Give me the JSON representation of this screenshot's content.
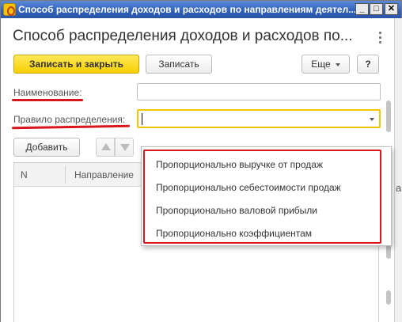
{
  "window": {
    "title": "Способ распределения доходов и расходов по направлениям деятел...",
    "min": "_",
    "max": "□",
    "close": "✕"
  },
  "form": {
    "title": "Способ распределения доходов и расходов по...",
    "more_icon": "vertical-dots-icon"
  },
  "toolbar": {
    "save_close_label": "Записать и закрыть",
    "save_label": "Записать",
    "more_label": "Еще",
    "help_label": "?"
  },
  "fields": {
    "name_label": "Наименование:",
    "name_value": "",
    "rule_label": "Правило распределения:",
    "rule_value": ""
  },
  "table_toolbar": {
    "add_label": "Добавить"
  },
  "table": {
    "columns": [
      "N",
      "Направление"
    ]
  },
  "dropdown": {
    "options": [
      "Пропорционально выручке от продаж",
      "Пропорционально себестоимости продаж",
      "Пропорционально валовой прибыли",
      "Пропорционально коэффициентам"
    ]
  },
  "background": {
    "text": "а"
  },
  "colors": {
    "accent": "#f7cf00",
    "highlight": "#e0141c",
    "titlebar": "#2f5fb8"
  }
}
